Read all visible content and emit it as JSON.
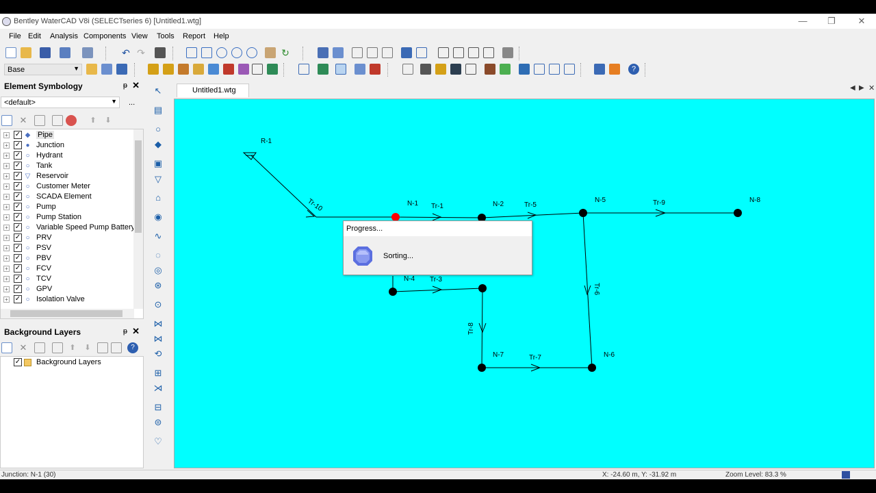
{
  "window": {
    "title": "Bentley WaterCAD V8i (SELECTseries 6) [Untitled1.wtg]",
    "minimize": "—",
    "restore": "❐",
    "close": "✕"
  },
  "menu": [
    "File",
    "Edit",
    "Analysis",
    "Components",
    "View",
    "Tools",
    "Report",
    "Help"
  ],
  "toolbar": {
    "scenario_combo": "Base"
  },
  "element_symbology": {
    "title": "Element Symbology",
    "pin": "ᵽ",
    "close": "✕",
    "filter_combo": "<default>",
    "filter_ellipsis": "...",
    "items": [
      {
        "label": "Pipe",
        "icon": "pipe-icon",
        "glyph": "◆"
      },
      {
        "label": "Junction",
        "icon": "junction-icon",
        "glyph": "●"
      },
      {
        "label": "Hydrant",
        "icon": "hydrant-icon",
        "glyph": "○"
      },
      {
        "label": "Tank",
        "icon": "tank-icon",
        "glyph": "○"
      },
      {
        "label": "Reservoir",
        "icon": "reservoir-icon",
        "glyph": "▽"
      },
      {
        "label": "Customer Meter",
        "icon": "customer-meter-icon",
        "glyph": "○"
      },
      {
        "label": "SCADA Element",
        "icon": "scada-element-icon",
        "glyph": "○"
      },
      {
        "label": "Pump",
        "icon": "pump-icon",
        "glyph": "○"
      },
      {
        "label": "Pump Station",
        "icon": "pump-station-icon",
        "glyph": "○"
      },
      {
        "label": "Variable Speed Pump Battery",
        "icon": "vspb-icon",
        "glyph": "○"
      },
      {
        "label": "PRV",
        "icon": "prv-icon",
        "glyph": "○"
      },
      {
        "label": "PSV",
        "icon": "psv-icon",
        "glyph": "○"
      },
      {
        "label": "PBV",
        "icon": "pbv-icon",
        "glyph": "○"
      },
      {
        "label": "FCV",
        "icon": "fcv-icon",
        "glyph": "○"
      },
      {
        "label": "TCV",
        "icon": "tcv-icon",
        "glyph": "○"
      },
      {
        "label": "GPV",
        "icon": "gpv-icon",
        "glyph": "○"
      },
      {
        "label": "Isolation Valve",
        "icon": "isolation-valve-icon",
        "glyph": "○"
      }
    ]
  },
  "background_layers": {
    "title": "Background Layers",
    "pin": "ᵽ",
    "close": "✕",
    "root_label": "Background Layers"
  },
  "document_tab": {
    "label": "Untitled1.wtg"
  },
  "network": {
    "reservoir_label": "R-1",
    "junctions": [
      "N-1",
      "N-2",
      "N-4",
      "N-5",
      "N-6",
      "N-7",
      "N-8"
    ],
    "pipes": [
      "Tr-1",
      "Tr-3",
      "Tr-5",
      "Tr-6",
      "Tr-7",
      "Tr-8",
      "Tr-9",
      "Tr-10"
    ],
    "highlighted_node": "N-1",
    "background_color": "#00ffff",
    "highlight_color": "#ff0000"
  },
  "progress_dialog": {
    "title": "Progress...",
    "message": "Sorting..."
  },
  "status": {
    "selection": "Junction: N-1 (30)",
    "coords": "X: -24.60 m, Y: -31.92 m",
    "zoom": "Zoom Level: 83.3 %"
  }
}
